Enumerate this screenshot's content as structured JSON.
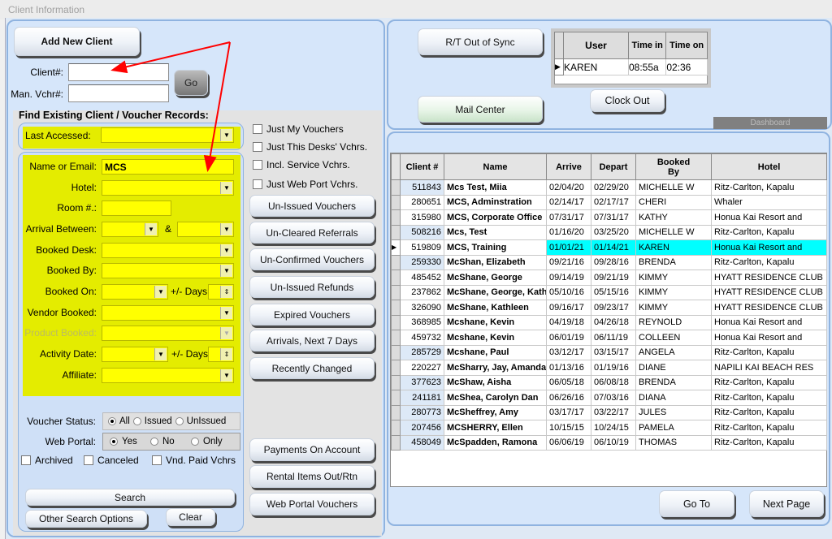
{
  "window": {
    "title": "Client Information"
  },
  "left": {
    "add_new_client": "Add New Client",
    "client_label": "Client#:",
    "client_value": "",
    "vchr_label": "Man. Vchr#:",
    "vchr_value": "",
    "go": "Go",
    "find_title": "Find Existing Client / Voucher Records:",
    "last_accessed": "Last Accessed:",
    "fields": {
      "name_email": {
        "label": "Name or Email:",
        "value": "MCS"
      },
      "hotel": "Hotel:",
      "room": "Room #.:",
      "arrival": "Arrival Between:",
      "amp": "&",
      "booked_desk": "Booked Desk:",
      "booked_by": "Booked By:",
      "booked_on": "Booked On:",
      "days": "+/- Days",
      "vendor": "Vendor Booked:",
      "product": "Product Booked:",
      "activity": "Activity Date:",
      "affiliate": "Affiliate:"
    },
    "voucher_status": {
      "label": "Voucher Status:",
      "options": [
        "All",
        "Issued",
        "UnIssued"
      ],
      "selected": "All"
    },
    "web_portal": {
      "label": "Web Portal:",
      "options": [
        "Yes",
        "No",
        "Only"
      ],
      "selected": "Yes"
    },
    "checks": [
      "Archived",
      "Canceled",
      "Vnd. Paid Vchrs"
    ],
    "search": "Search",
    "other_search": "Other Search Options",
    "clear": "Clear"
  },
  "middle": {
    "checks": [
      "Just My Vouchers",
      "Just This Desks' Vchrs.",
      "Incl. Service Vchrs.",
      "Just Web Port Vchrs."
    ],
    "buttons": [
      "Un-Issued Vouchers",
      "Un-Cleared Referrals",
      "Un-Confirmed Vouchers",
      "Un-Issued Refunds",
      "Expired Vouchers",
      "Arrivals, Next 7 Days",
      "Recently Changed"
    ],
    "lower_buttons": [
      "Payments On Account",
      "Rental Items Out/Rtn",
      "Web Portal Vouchers"
    ]
  },
  "top_right": {
    "rt_sync": "R/T Out of Sync",
    "mail_center": "Mail Center",
    "clock_out": "Clock Out",
    "dashboard": "Dashboard",
    "user_table": {
      "headers": [
        "User",
        "Time in",
        "Time on"
      ],
      "row": [
        "KAREN",
        "08:55a",
        "02:36"
      ]
    }
  },
  "grid": {
    "headers": [
      "Client #",
      "Name",
      "Arrive",
      "Depart",
      "Booked By",
      "Hotel"
    ],
    "rows": [
      [
        "511843",
        "Mcs Test, Miia",
        "02/04/20",
        "02/29/20",
        "MICHELLE W",
        "Ritz-Carlton, Kapalu"
      ],
      [
        "280651",
        "MCS, Adminstration",
        "02/14/17",
        "02/17/17",
        "CHERI",
        "Whaler"
      ],
      [
        "315980",
        "MCS, Corporate Office",
        "07/31/17",
        "07/31/17",
        "KATHY",
        "Honua Kai Resort and"
      ],
      [
        "508216",
        "Mcs, Test",
        "01/16/20",
        "03/25/20",
        "MICHELLE W",
        "Ritz-Carlton, Kapalu"
      ],
      [
        "519809",
        "MCS, Training",
        "01/01/21",
        "01/14/21",
        "KAREN",
        "Honua Kai Resort and"
      ],
      [
        "259330",
        "McShan, Elizabeth",
        "09/21/16",
        "09/28/16",
        "BRENDA",
        "Ritz-Carlton, Kapalu"
      ],
      [
        "485452",
        "McShane, George",
        "09/14/19",
        "09/21/19",
        "KIMMY",
        "HYATT RESIDENCE CLUB"
      ],
      [
        "237862",
        "McShane, George, Kath...",
        "05/10/16",
        "05/15/16",
        "KIMMY",
        "HYATT RESIDENCE CLUB"
      ],
      [
        "326090",
        "McShane, Kathleen",
        "09/16/17",
        "09/23/17",
        "KIMMY",
        "HYATT RESIDENCE CLUB"
      ],
      [
        "368985",
        "Mcshane, Kevin",
        "04/19/18",
        "04/26/18",
        "REYNOLD",
        "Honua Kai Resort and"
      ],
      [
        "459732",
        "Mcshane, Kevin",
        "06/01/19",
        "06/11/19",
        "COLLEEN",
        "Honua Kai Resort and"
      ],
      [
        "285729",
        "Mcshane, Paul",
        "03/12/17",
        "03/15/17",
        "ANGELA",
        "Ritz-Carlton, Kapalu"
      ],
      [
        "220227",
        "McSharry, Jay, Amanda",
        "01/13/16",
        "01/19/16",
        "DIANE",
        "NAPILI KAI BEACH RES"
      ],
      [
        "377623",
        "McShaw, Aisha",
        "06/05/18",
        "06/08/18",
        "BRENDA",
        "Ritz-Carlton, Kapalu"
      ],
      [
        "241181",
        "McShea, Carolyn  Dan",
        "06/26/16",
        "07/03/16",
        "DIANA",
        "Ritz-Carlton, Kapalu"
      ],
      [
        "280773",
        "McSheffrey, Amy",
        "03/17/17",
        "03/22/17",
        "JULES",
        "Ritz-Carlton, Kapalu"
      ],
      [
        "207456",
        "MCSHERRY, Ellen",
        "10/15/15",
        "10/24/15",
        "PAMELA",
        "Ritz-Carlton, Kapalu"
      ],
      [
        "458049",
        "McSpadden, Ramona",
        "06/06/19",
        "06/10/19",
        "THOMAS",
        "Ritz-Carlton, Kapalu"
      ]
    ],
    "current_row": 4,
    "highlight_color": "#00ffff",
    "go_to": "Go To",
    "next_page": "Next Page"
  },
  "annotation": {
    "arrow_color": "#ff0000"
  }
}
